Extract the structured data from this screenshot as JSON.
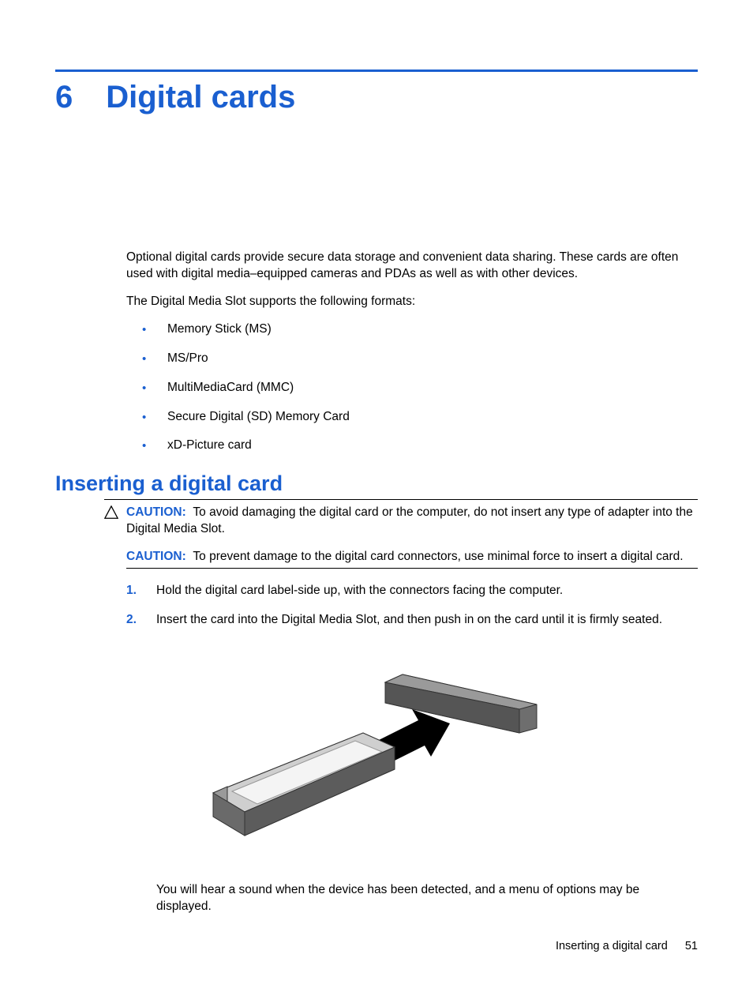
{
  "chapter": {
    "number": "6",
    "title": "Digital cards"
  },
  "intro": {
    "p1": "Optional digital cards provide secure data storage and convenient data sharing. These cards are often used with digital media–equipped cameras and PDAs as well as with other devices.",
    "p2": "The Digital Media Slot supports the following formats:"
  },
  "formats": [
    "Memory Stick (MS)",
    "MS/Pro",
    "MultiMediaCard (MMC)",
    "Secure Digital (SD) Memory Card",
    "xD-Picture card"
  ],
  "section_heading": "Inserting a digital card",
  "caution1": {
    "label": "CAUTION:",
    "text": "To avoid damaging the digital card or the computer, do not insert any type of adapter into the Digital Media Slot."
  },
  "caution2": {
    "label": "CAUTION:",
    "text": "To prevent damage to the digital card connectors, use minimal force to insert a digital card."
  },
  "steps": [
    "Hold the digital card label-side up, with the connectors facing the computer.",
    "Insert the card into the Digital Media Slot, and then push in on the card until it is firmly seated."
  ],
  "after": "You will hear a sound when the device has been detected, and a menu of options may be displayed.",
  "footer": {
    "section": "Inserting a digital card",
    "page": "51"
  }
}
